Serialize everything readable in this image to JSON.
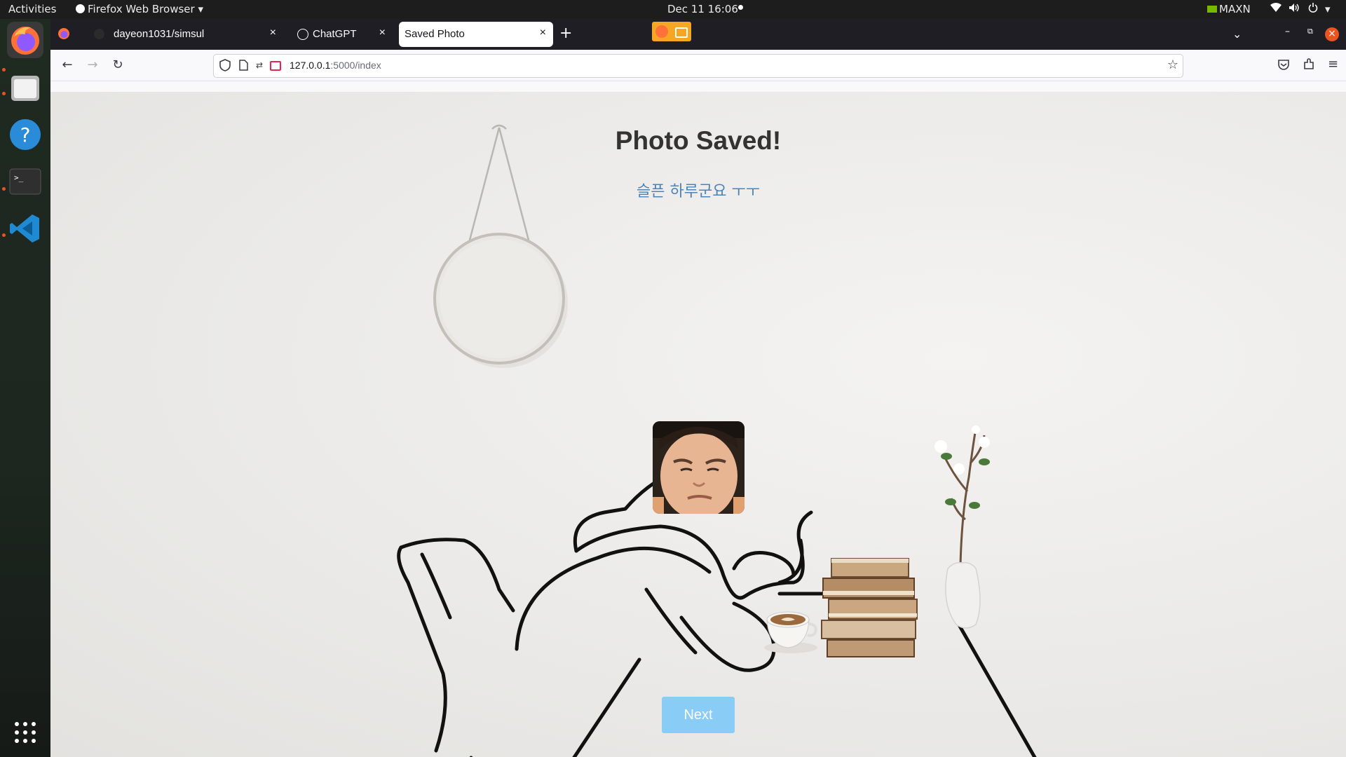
{
  "system": {
    "activities": "Activities",
    "app_menu": "Firefox Web Browser",
    "clock": "Dec 11  16:06",
    "power_mode": "MAXN"
  },
  "dock": {
    "items": [
      "firefox-icon",
      "files-icon",
      "help-icon",
      "terminal-icon",
      "vscode-icon"
    ],
    "show_apps": "app-grid-icon"
  },
  "browser": {
    "tabs": [
      {
        "label": "dayeon1031/simsul",
        "active": false
      },
      {
        "label": "ChatGPT",
        "active": false
      },
      {
        "label": "Saved Photo",
        "active": true
      }
    ],
    "new_tab": "+",
    "url_host": "127.0.0.1",
    "url_rest": ":5000/index"
  },
  "page": {
    "title": "Photo Saved!",
    "message": "슬픈 하루군요 ㅜㅜ",
    "next_label": "Next"
  },
  "colors": {
    "accent": "#89ccf6",
    "message": "#4a84b8",
    "urgent_dot": "#e95420"
  }
}
